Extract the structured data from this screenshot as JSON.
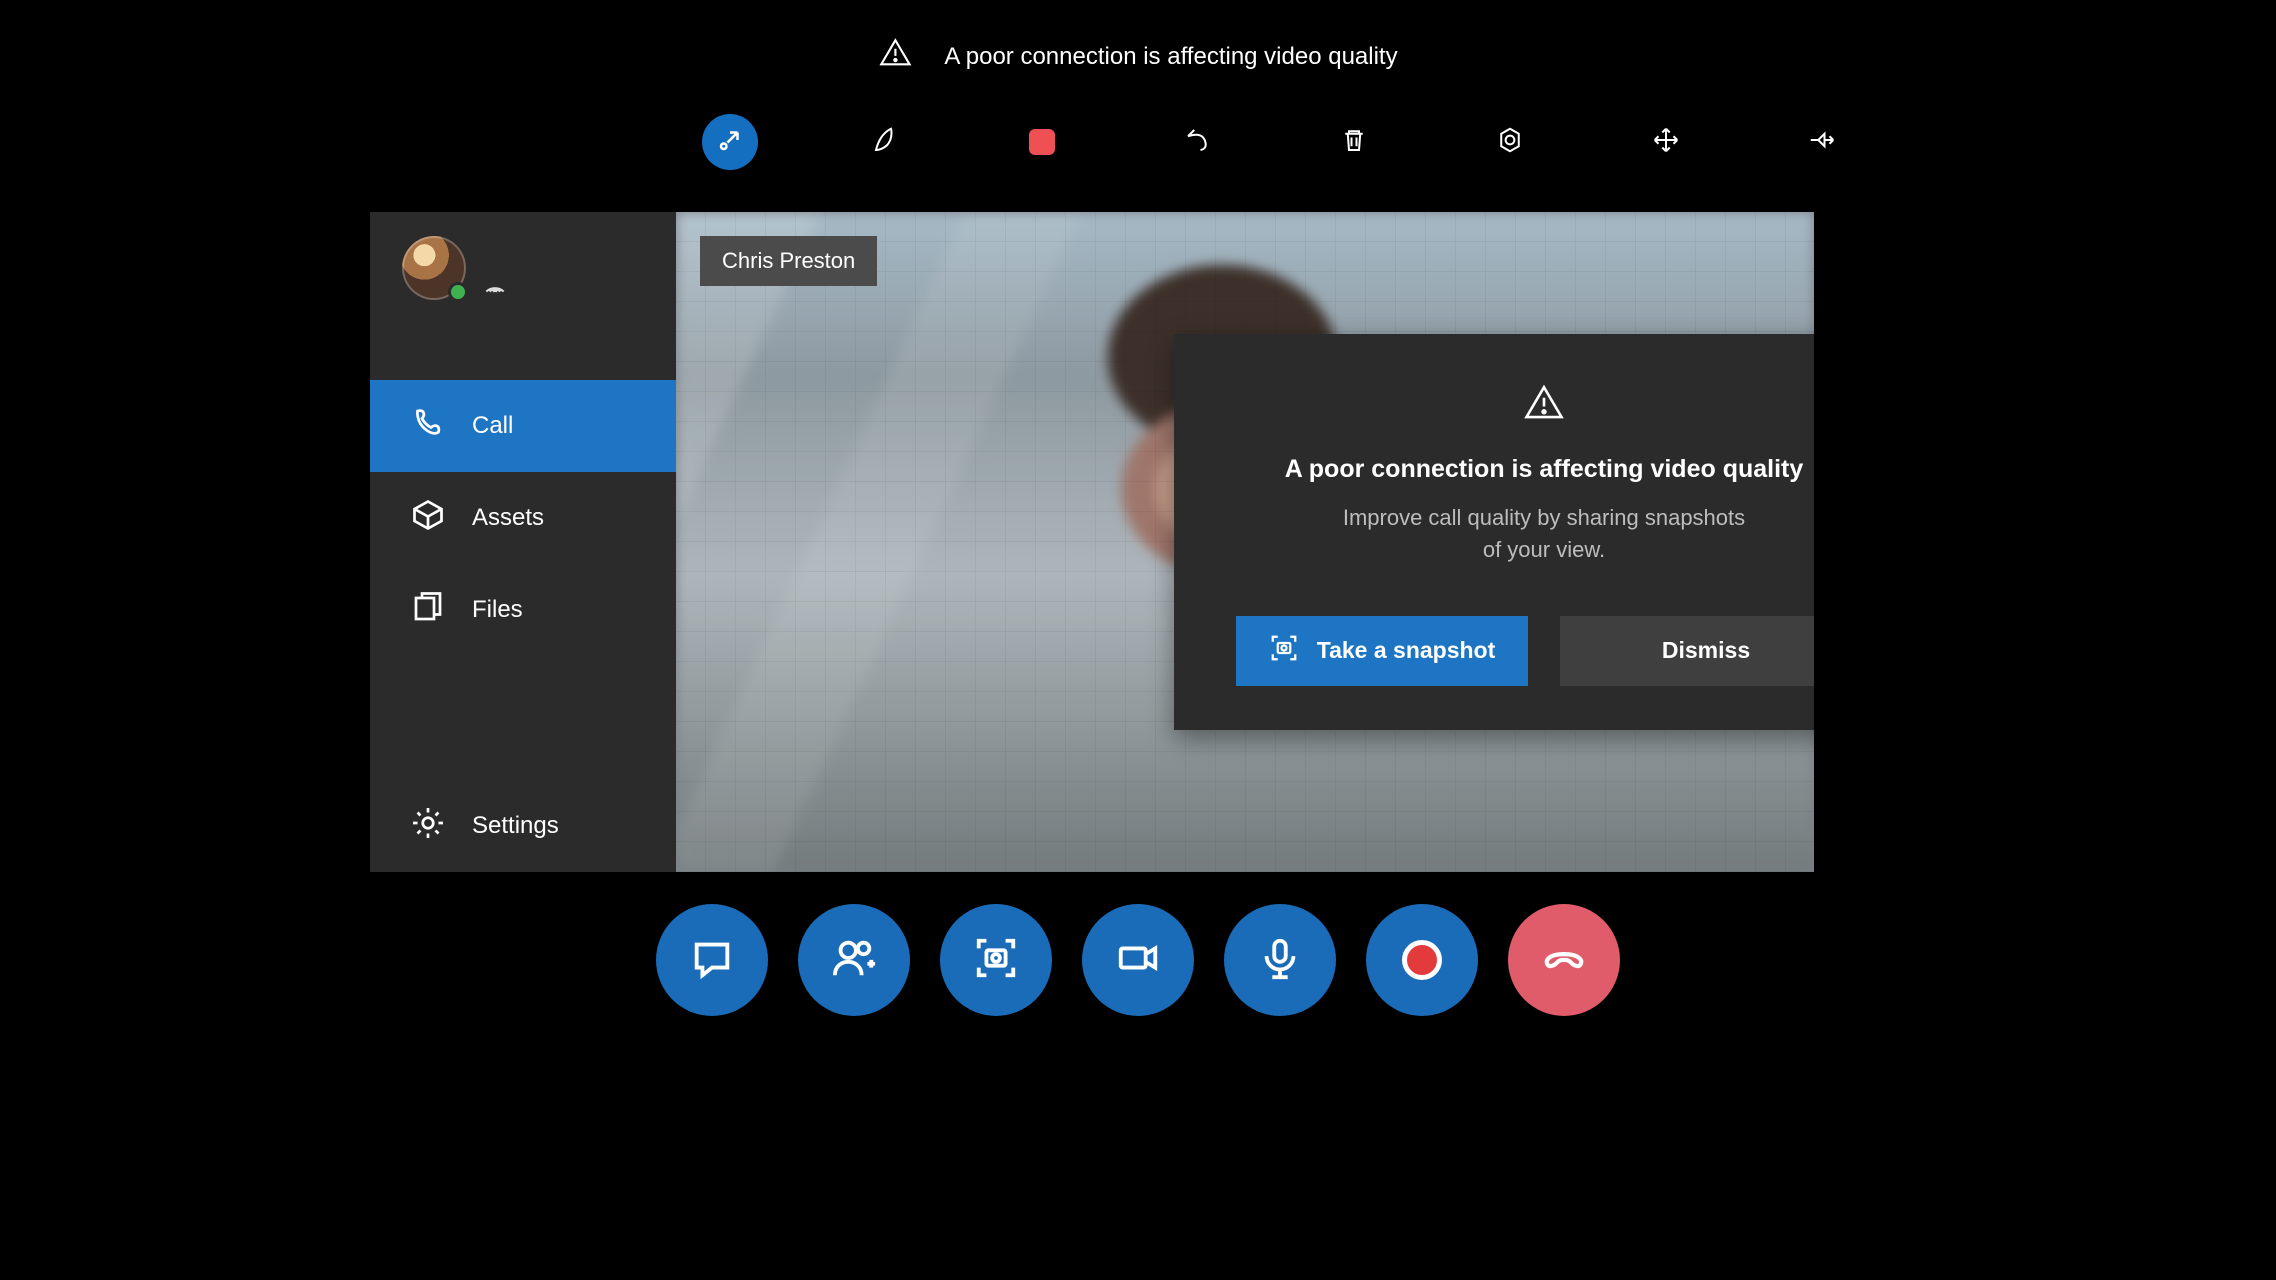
{
  "banner": {
    "text": "A poor connection is affecting video quality"
  },
  "toolbar": {
    "collapse_icon": "collapse-arrow-icon",
    "pen_icon": "pen-icon",
    "eraser_icon": "eraser-icon",
    "undo_icon": "undo-icon",
    "delete_icon": "trash-icon",
    "settings_icon": "aperture-icon",
    "move_icon": "move-arrows-icon",
    "pin_icon": "pin-icon"
  },
  "sidebar": {
    "items": [
      {
        "icon": "phone-icon",
        "label": "Call",
        "active": true
      },
      {
        "icon": "cube-icon",
        "label": "Assets",
        "active": false
      },
      {
        "icon": "files-icon",
        "label": "Files",
        "active": false
      },
      {
        "icon": "gear-icon",
        "label": "Settings",
        "active": false
      }
    ]
  },
  "video": {
    "participant_name": "Chris Preston"
  },
  "dialog": {
    "title": "A poor connection is affecting video quality",
    "body_line1": "Improve call quality by sharing snapshots",
    "body_line2": "of your view.",
    "primary_label": "Take a snapshot",
    "secondary_label": "Dismiss"
  },
  "callbar": {
    "chat_icon": "chat-icon",
    "people_icon": "add-people-icon",
    "snapshot_icon": "camera-frame-icon",
    "video_icon": "videocam-icon",
    "mic_icon": "mic-icon",
    "record_icon": "record-icon",
    "hangup_icon": "hangup-icon"
  }
}
